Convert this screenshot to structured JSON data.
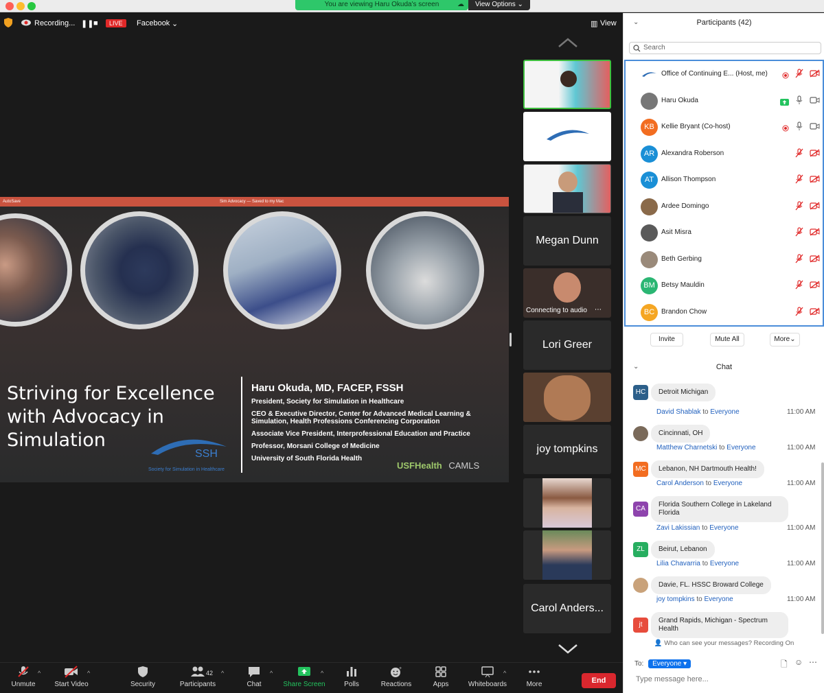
{
  "banner": {
    "viewing": "You are viewing Haru Okuda's screen",
    "view_options": "View Options"
  },
  "topbar": {
    "recording": "Recording...",
    "live": "LIVE",
    "platform": "Facebook",
    "view": "View"
  },
  "slide": {
    "title_bar": "Sim Advocacy — Saved to my Mac",
    "title": "Striving for Excellence with Advocacy in Simulation",
    "speaker": "Haru Okuda, MD, FACEP, FSSH",
    "lines": [
      "President, Society for Simulation in Healthcare",
      "CEO & Executive Director, Center for Advanced Medical Learning & Simulation, Health Professions Conferencing Corporation",
      "Associate Vice President, Interprofessional Education and Practice",
      "Professor, Morsani College of Medicine",
      "University of South Florida Health"
    ],
    "ssh_logo": "SSH",
    "ssh_caption": "Society for Simulation in Healthcare",
    "usf_logo": "USFHealth",
    "camls_logo": "CAMLS"
  },
  "gallery": {
    "tiles": [
      {
        "name": "",
        "kind": "video-highlight"
      },
      {
        "name": "",
        "kind": "logo"
      },
      {
        "name": "",
        "kind": "video"
      },
      {
        "name": "Megan Dunn",
        "kind": "name"
      },
      {
        "name": "Connecting to audio",
        "kind": "video-caption"
      },
      {
        "name": "Lori Greer",
        "kind": "name"
      },
      {
        "name": "",
        "kind": "video"
      },
      {
        "name": "joy tompkins",
        "kind": "name"
      },
      {
        "name": "",
        "kind": "video"
      },
      {
        "name": "",
        "kind": "video"
      },
      {
        "name": "Carol Anders...",
        "kind": "name"
      }
    ]
  },
  "toolbar": {
    "unmute": "Unmute",
    "start_video": "Start Video",
    "security": "Security",
    "participants": "Participants",
    "participants_count": "42",
    "chat": "Chat",
    "share_screen": "Share Screen",
    "polls": "Polls",
    "reactions": "Reactions",
    "apps": "Apps",
    "whiteboards": "Whiteboards",
    "more": "More",
    "end": "End"
  },
  "panel": {
    "participants_title": "Participants (42)",
    "search_placeholder": "Search",
    "participants": [
      {
        "name": "Office of Continuing E...  (Host, me)",
        "initials": "",
        "color": "#ffffff"
      },
      {
        "name": "Haru Okuda",
        "initials": "",
        "color": "#777777"
      },
      {
        "name": "Kellie Bryant (Co-host)",
        "initials": "KB",
        "color": "#f26d21"
      },
      {
        "name": "Alexandra Roberson",
        "initials": "AR",
        "color": "#1a8fd6"
      },
      {
        "name": "Allison Thompson",
        "initials": "AT",
        "color": "#1a8fd6"
      },
      {
        "name": "Ardee Domingo",
        "initials": "",
        "color": "#8a6a4a"
      },
      {
        "name": "Asit Misra",
        "initials": "",
        "color": "#5a5a5a"
      },
      {
        "name": "Beth Gerbing",
        "initials": "",
        "color": "#9a8a7a"
      },
      {
        "name": "Betsy Mauldin",
        "initials": "BM",
        "color": "#2bb673"
      },
      {
        "name": "Brandon Chow",
        "initials": "BC",
        "color": "#f5a623"
      }
    ],
    "invite": "Invite",
    "mute_all": "Mute All",
    "more": "More",
    "chat_title": "Chat",
    "messages": [
      {
        "sender": "",
        "to": "",
        "time": "",
        "text": "Detroit Michigan",
        "initials": "HC",
        "color": "#2c5f8a"
      },
      {
        "sender": "David Shablak",
        "to": "Everyone",
        "time": "11:00 AM",
        "text": "Cincinnati, OH",
        "initials": "",
        "color": "#7a6a5a"
      },
      {
        "sender": "Matthew Charnetski",
        "to": "Everyone",
        "time": "11:00 AM",
        "text": "Lebanon, NH Dartmouth Health!",
        "initials": "MC",
        "color": "#f26d21"
      },
      {
        "sender": "Carol Anderson",
        "to": "Everyone",
        "time": "11:00 AM",
        "text": "Florida Southern College in Lakeland Florida",
        "initials": "CA",
        "color": "#8e44ad"
      },
      {
        "sender": "Zavi Lakissian",
        "to": "Everyone",
        "time": "11:00 AM",
        "text": "Beirut, Lebanon",
        "initials": "ZL",
        "color": "#27ae60"
      },
      {
        "sender": "Lilia Chavarria",
        "to": "Everyone",
        "time": "11:00 AM",
        "text": "Davie, FL. HSSC Broward College",
        "initials": "",
        "color": "#c9a27a"
      },
      {
        "sender": "joy tompkins",
        "to": "Everyone",
        "time": "11:00 AM",
        "text": "Grand Rapids, Michigan - Spectrum Health",
        "initials": "jt",
        "color": "#e74c3c"
      }
    ],
    "to_word": "to",
    "who_can_see": "Who can see your messages? Recording On",
    "to_label": "To:",
    "to_value": "Everyone",
    "input_placeholder": "Type message here..."
  }
}
